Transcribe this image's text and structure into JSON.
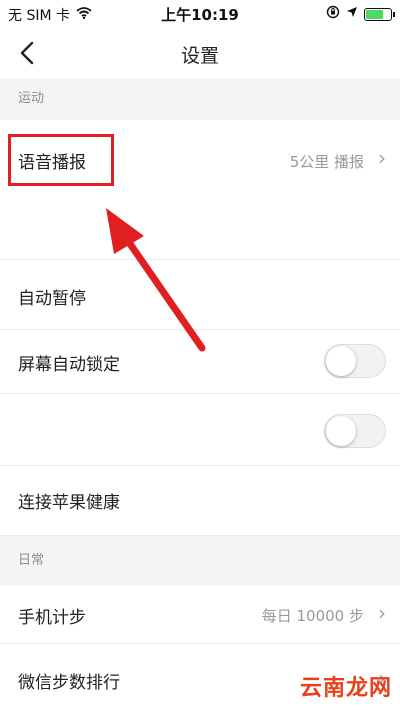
{
  "status_bar": {
    "carrier": "无 SIM 卡",
    "time": "上午10:19",
    "wifi_icon": "wifi-icon",
    "battery_color": "#4cd964",
    "battery_level": 0.75
  },
  "nav": {
    "title": "设置",
    "back_icon": "chevron-left-icon"
  },
  "sections": {
    "sport": {
      "header": "运动",
      "voice_label": "语音播报",
      "voice_value": "5公里 播报",
      "auto_pause_label": "自动暂停",
      "screen_lock_label": "屏幕自动锁定",
      "apple_health_label": "连接苹果健康"
    },
    "daily": {
      "header": "日常",
      "step_label": "手机计步",
      "step_value": "每日 10000 步",
      "wechat_label": "微信步数排行"
    }
  },
  "annotation": {
    "highlight_color": "#e02020"
  },
  "watermark": "云南龙网"
}
